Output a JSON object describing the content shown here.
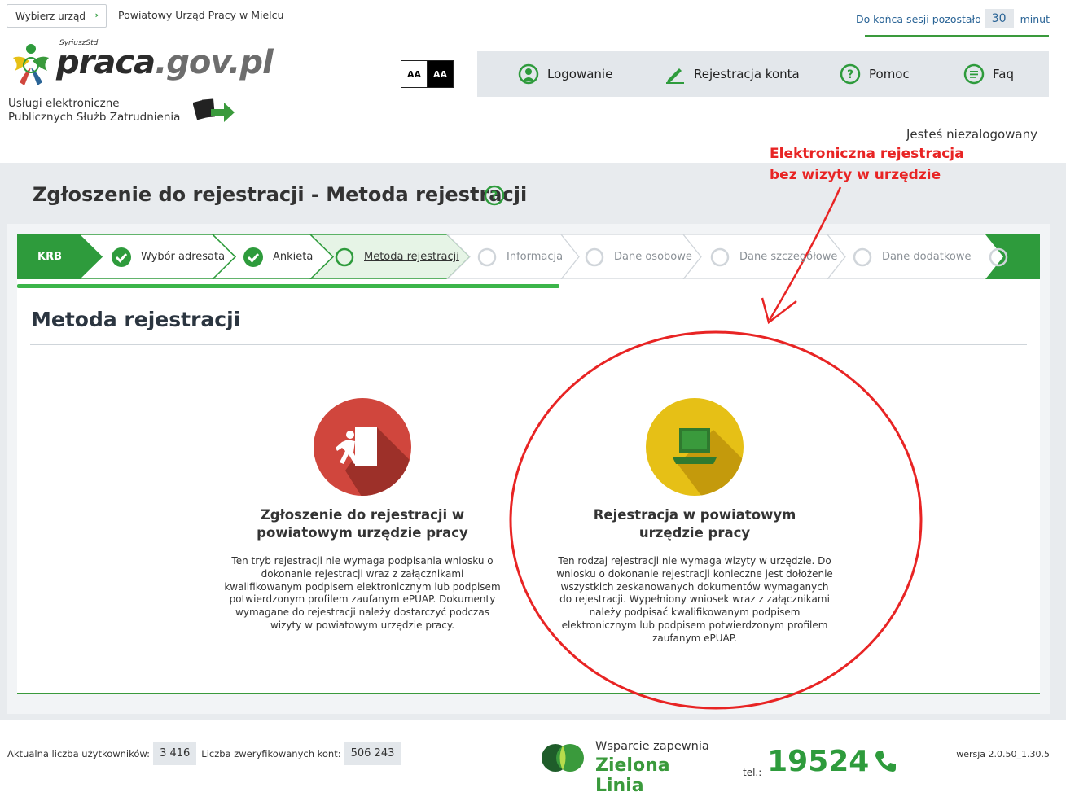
{
  "top": {
    "office_select_label": "Wybierz urząd",
    "office_name": "Powiatowy Urząd Pracy w Mielcu",
    "session_prefix": "Do końca sesji pozostało",
    "session_minutes": "30",
    "session_suffix": "minut"
  },
  "logo": {
    "superscript": "SyriuszStd",
    "brand_main": "praca",
    "brand_rest": ".gov.pl",
    "services_line1": "Usługi elektroniczne",
    "services_line2": "Publicznych Służb Zatrudnienia"
  },
  "contrast": {
    "normal_label": "AA",
    "high_label": "AA"
  },
  "nav": {
    "login": "Logowanie",
    "register": "Rejestracja konta",
    "help": "Pomoc",
    "faq": "Faq"
  },
  "user_status": "Jesteś niezalogowany",
  "annotation": {
    "line1": "Elektroniczna rejestracja",
    "line2": "bez wizyty w urzędzie"
  },
  "page_title": "Zgłoszenie do rejestracji - Metoda rejestracji",
  "stepper": {
    "start_label": "KRB",
    "steps": [
      {
        "label": "Wybór adresata",
        "state": "done"
      },
      {
        "label": "Ankieta",
        "state": "done"
      },
      {
        "label": "Metoda rejestracji",
        "state": "current"
      },
      {
        "label": "Informacja",
        "state": "todo"
      },
      {
        "label": "Dane osobowe",
        "state": "todo"
      },
      {
        "label": "Dane szczegółowe",
        "state": "todo"
      },
      {
        "label": "Dane dodatkowe",
        "state": "todo"
      }
    ],
    "progress_fraction": 0.53
  },
  "section_title": "Metoda rejestracji",
  "options": [
    {
      "title": "Zgłoszenie do rejestracji w powiatowym urzędzie pracy",
      "description": "Ten tryb rejestracji nie wymaga podpisania wniosku o dokonanie rejestracji wraz z załącznikami kwalifikowanym podpisem elektronicznym lub podpisem potwierdzonym profilem zaufanym ePUAP. Dokumenty wymagane do rejestracji należy dostarczyć podczas wizyty w powiatowym urzędzie pracy."
    },
    {
      "title": "Rejestracja w powiatowym urzędzie pracy",
      "description": "Ten rodzaj rejestracji nie wymaga wizyty w urzędzie. Do wniosku o dokonanie rejestracji konieczne jest dołożenie wszystkich zeskanowanych dokumentów wymaganych do rejestracji. Wypełniony wniosek wraz z załącznikami należy podpisać kwalifikowanym podpisem elektronicznym lub podpisem potwierdzonym profilem zaufanym ePUAP."
    }
  ],
  "footer": {
    "users_label": "Aktualna liczba użytkowników:",
    "users_value": "3 416",
    "verified_label": "Liczba zweryfikowanych kont:",
    "verified_value": "506 243",
    "support_line1": "Wsparcie zapewnia",
    "support_line2": "Zielona Linia",
    "tel_label": "tel.:",
    "tel_number": "19524",
    "version": "wersja 2.0.50_1.30.5"
  },
  "colors": {
    "brand_green": "#3a9a3c",
    "stepper_green": "#2e9b3c",
    "annotation_red": "#e82424",
    "option_red": "#d0463d",
    "option_yellow": "#e6c016"
  }
}
